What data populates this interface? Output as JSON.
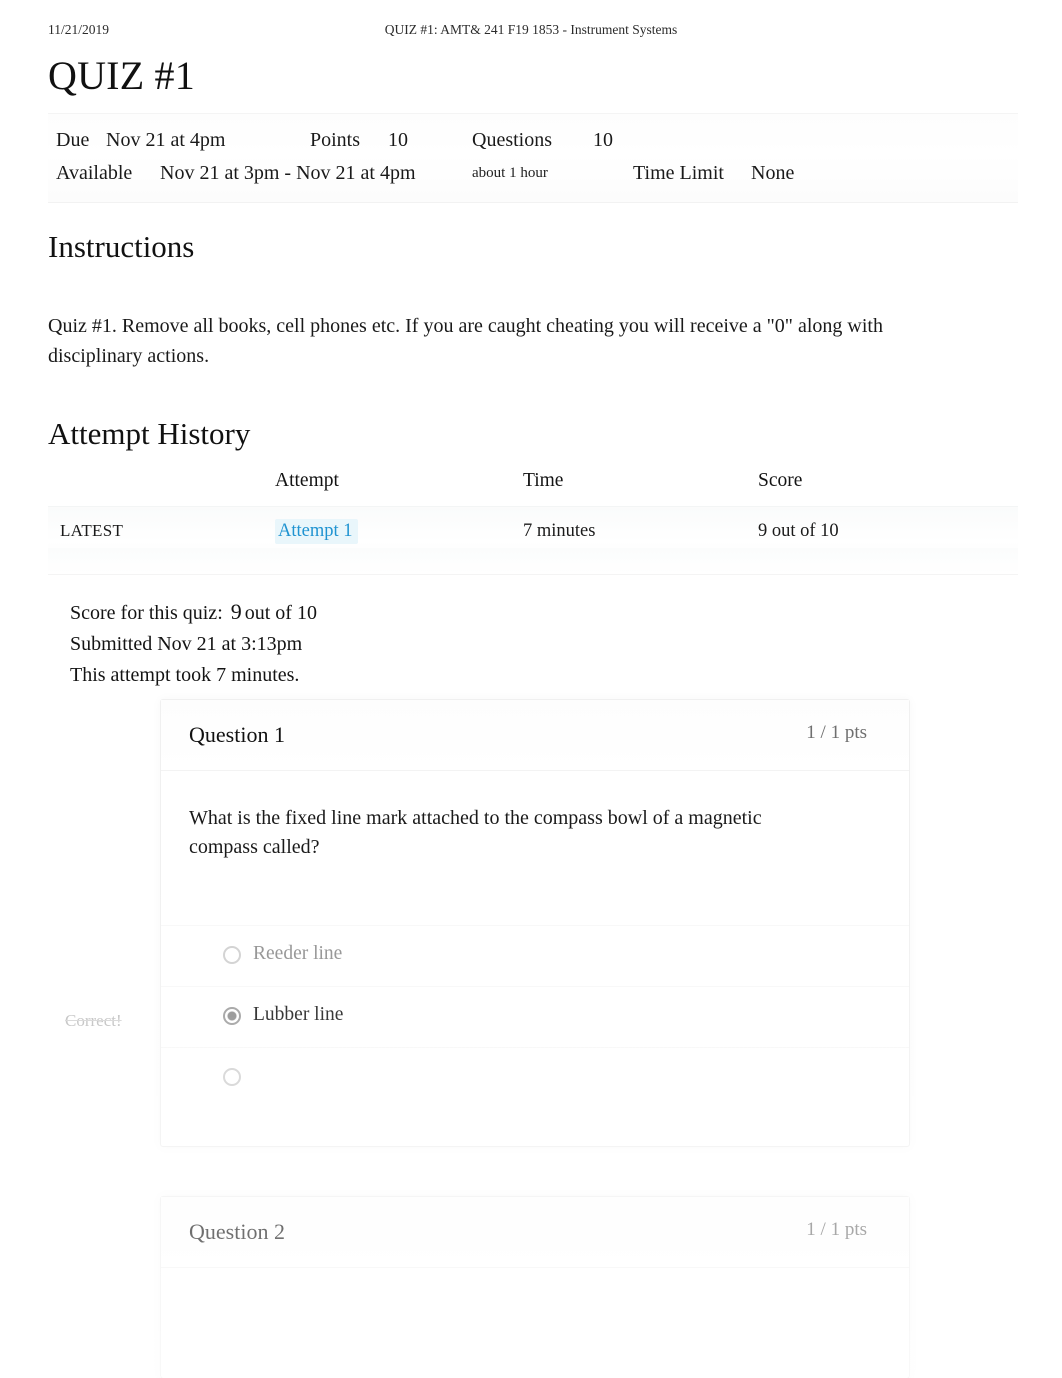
{
  "print_header": {
    "date": "11/21/2019",
    "title": "QUIZ #1: AMT& 241 F19 1853 - Instrument Systems"
  },
  "page_title": "QUIZ #1",
  "details": {
    "due_label": "Due",
    "due_value": "Nov 21 at 4pm",
    "points_label": "Points",
    "points_value": "10",
    "questions_label": "Questions",
    "questions_value": "10",
    "available_label": "Available",
    "available_value": "Nov 21 at 3pm - Nov 21 at 4pm",
    "duration_note": "about 1 hour",
    "time_limit_label": "Time Limit",
    "time_limit_value": "None"
  },
  "instructions": {
    "heading": "Instructions",
    "body": "Quiz #1. Remove all books, cell phones etc. If you are caught cheating you will receive a \"0\" along with disciplinary actions."
  },
  "attempt_history": {
    "heading": "Attempt History",
    "columns": [
      "",
      "Attempt",
      "Time",
      "Score"
    ],
    "rows": [
      {
        "kept": "LATEST",
        "attempt": "Attempt 1",
        "time": "7 minutes",
        "score": "9 out of 10"
      }
    ]
  },
  "score_summary": {
    "score_label": "Score for this quiz:",
    "score_value": "9",
    "score_suffix": "out of 10",
    "submitted": "Submitted Nov 21 at 3:13pm",
    "duration": "This attempt took 7 minutes."
  },
  "questions": [
    {
      "name": "Question 1",
      "points": "1 / 1 pts",
      "text": "What is the fixed line mark attached to the compass bowl of a magnetic compass called?",
      "correct_flag": "Correct!",
      "answers": [
        {
          "label": "Reeder line",
          "selected": false,
          "visible": true
        },
        {
          "label": "Lubber line",
          "selected": true,
          "visible": true
        },
        {
          "label": "",
          "selected": false,
          "visible": false
        }
      ]
    },
    {
      "name": "Question 2",
      "points": "1 / 1 pts",
      "text": "",
      "correct_flag": "",
      "answers": []
    }
  ],
  "colors": {
    "link": "#1f93d1",
    "link_highlight": "#e9f6fb",
    "muted": "#6f6f6f",
    "text": "#1a1a1a"
  }
}
